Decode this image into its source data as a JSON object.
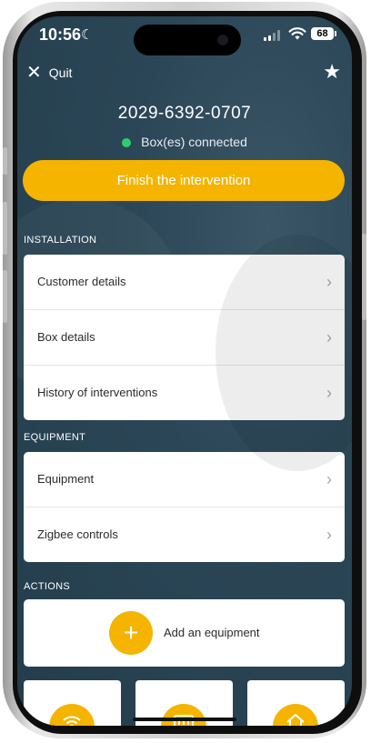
{
  "status_bar": {
    "time": "10:56",
    "battery": "68"
  },
  "header": {
    "quit_label": "Quit",
    "box_id": "2029-6392-0707",
    "connection_status": "Box(es) connected",
    "connection_color": "#2ecc71"
  },
  "primary_action": {
    "label": "Finish the intervention",
    "color": "#f4b400"
  },
  "installation": {
    "title": "INSTALLATION",
    "items": [
      {
        "label": "Customer details"
      },
      {
        "label": "Box details"
      },
      {
        "label": "History of interventions"
      }
    ]
  },
  "equipment": {
    "title": "EQUIPMENT",
    "items": [
      {
        "label": "Equipment"
      },
      {
        "label": "Zigbee controls"
      }
    ]
  },
  "actions": {
    "title": "ACTIONS",
    "add_label": "Add an equipment",
    "tiles": [
      {
        "icon": "wifi-icon"
      },
      {
        "icon": "box-device-icon"
      },
      {
        "icon": "home-icon"
      }
    ]
  },
  "icons": {
    "quit": "close-icon",
    "favorite": "star-icon",
    "row_chevron": "chevron-right-icon",
    "add": "plus-icon"
  }
}
